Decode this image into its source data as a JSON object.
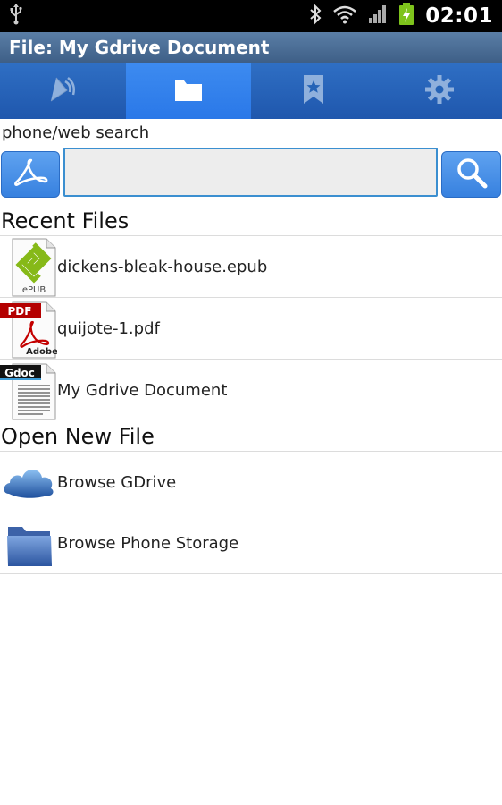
{
  "status_bar": {
    "time": "02:01",
    "icons": [
      "usb-icon",
      "bluetooth-icon",
      "wifi-icon",
      "signal-icon",
      "battery-charging-icon"
    ]
  },
  "title_bar": {
    "title": "File: My Gdrive Document"
  },
  "tabs": [
    {
      "icon": "audio-icon",
      "selected": false
    },
    {
      "icon": "folder-icon",
      "selected": true
    },
    {
      "icon": "bookmark-star-icon",
      "selected": false
    },
    {
      "icon": "gear-icon",
      "selected": false
    }
  ],
  "search": {
    "label": "phone/web search",
    "value": "",
    "pdf_button_icon": "adobe-pdf-icon",
    "search_button_icon": "search-icon"
  },
  "recent_files": {
    "header": "Recent Files",
    "items": [
      {
        "name": "dickens-bleak-house.epub",
        "icon": "epub-file-icon",
        "icon_text": "ePUB"
      },
      {
        "name": "quijote-1.pdf",
        "icon": "pdf-file-icon",
        "icon_text": "PDF",
        "icon_subtext": "Adobe"
      },
      {
        "name": "My Gdrive Document",
        "icon": "gdoc-file-icon",
        "icon_text": "Gdoc"
      }
    ]
  },
  "open_new_file": {
    "header": "Open New File",
    "items": [
      {
        "name": "Browse GDrive",
        "icon": "cloud-icon"
      },
      {
        "name": "Browse Phone Storage",
        "icon": "folder-icon"
      }
    ]
  },
  "colors": {
    "title_bar": "#4a6d96",
    "tab_bar": "#2563b6",
    "tab_selected": "#3384ee",
    "button_blue": "#4a92e8",
    "input_border": "#3b8fd0"
  }
}
